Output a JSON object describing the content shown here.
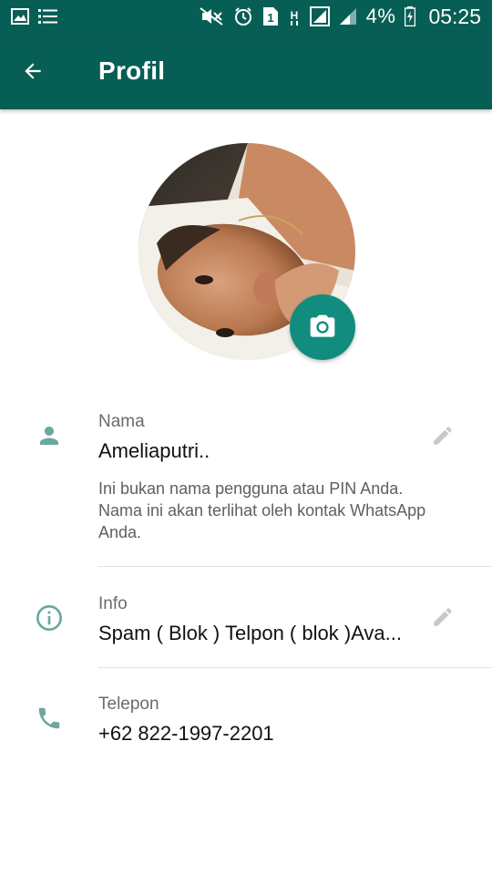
{
  "status_bar": {
    "battery_percent": "4%",
    "time": "05:25",
    "sim_badge": "1",
    "icons": [
      "image-icon",
      "list-icon",
      "mute-icon",
      "alarm-icon",
      "sim-icon",
      "h-signal-icon",
      "signal-icon",
      "signal-icon-2",
      "battery-charging-icon"
    ]
  },
  "appbar": {
    "title": "Profil",
    "back_icon": "arrow-back-icon"
  },
  "avatar": {
    "camera_icon": "camera-icon"
  },
  "name_section": {
    "label": "Nama",
    "value": "Ameliaputri..",
    "help": "Ini bukan nama pengguna atau PIN Anda. Nama ini akan terlihat oleh kontak WhatsApp Anda.",
    "icon": "person-icon",
    "edit_icon": "pencil-icon"
  },
  "info_section": {
    "label": "Info",
    "value": "Spam ( Blok ) Telpon ( blok )Ava...",
    "icon": "info-icon",
    "edit_icon": "pencil-icon"
  },
  "phone_section": {
    "label": "Telepon",
    "value": "+62 822-1997-2201",
    "icon": "phone-icon"
  },
  "colors": {
    "primary_dark": "#075e54",
    "accent": "#128c7e",
    "icon_teal": "#6aa89f",
    "edit_grey": "#c8c8c8"
  }
}
